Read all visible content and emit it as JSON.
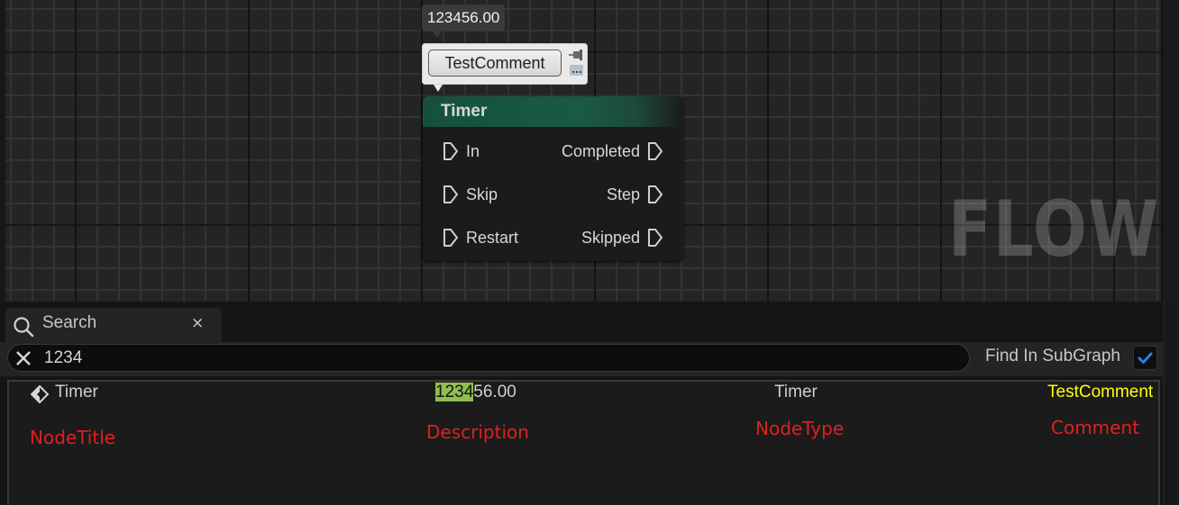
{
  "graph": {
    "watermark": "FLOW",
    "description_bubble": "123456.00",
    "comment_bubble": {
      "text": "TestComment",
      "pin_icon": "pin-icon",
      "menu_icon": "comment-options-icon"
    },
    "node": {
      "title": "Timer",
      "header_color": "#195a44",
      "input_pins": [
        "In",
        "Skip",
        "Restart"
      ],
      "output_pins": [
        "Completed",
        "Step",
        "Skipped"
      ]
    }
  },
  "search_panel": {
    "tab": {
      "icon": "search-icon",
      "label": "Search",
      "close_icon": "close-icon",
      "close_glyph": "×"
    },
    "search_field": {
      "value": "1234",
      "clear_icon": "clear-icon"
    },
    "find_in_subgraph": {
      "label": "Find In SubGraph",
      "checked": true,
      "check_color": "#2a7fe0"
    },
    "results": [
      {
        "icon": "node-icon",
        "node_title": "Timer",
        "description_match": "1234",
        "description_rest": "56.00",
        "node_type": "Timer",
        "comment": "TestComment"
      }
    ],
    "highlight_color": "#8fbe4e",
    "comment_color": "#ffff10"
  },
  "annotations": {
    "node_title": "NodeTitle",
    "description": "Description",
    "node_type": "NodeType",
    "comment": "Comment",
    "color": "#e02020"
  }
}
